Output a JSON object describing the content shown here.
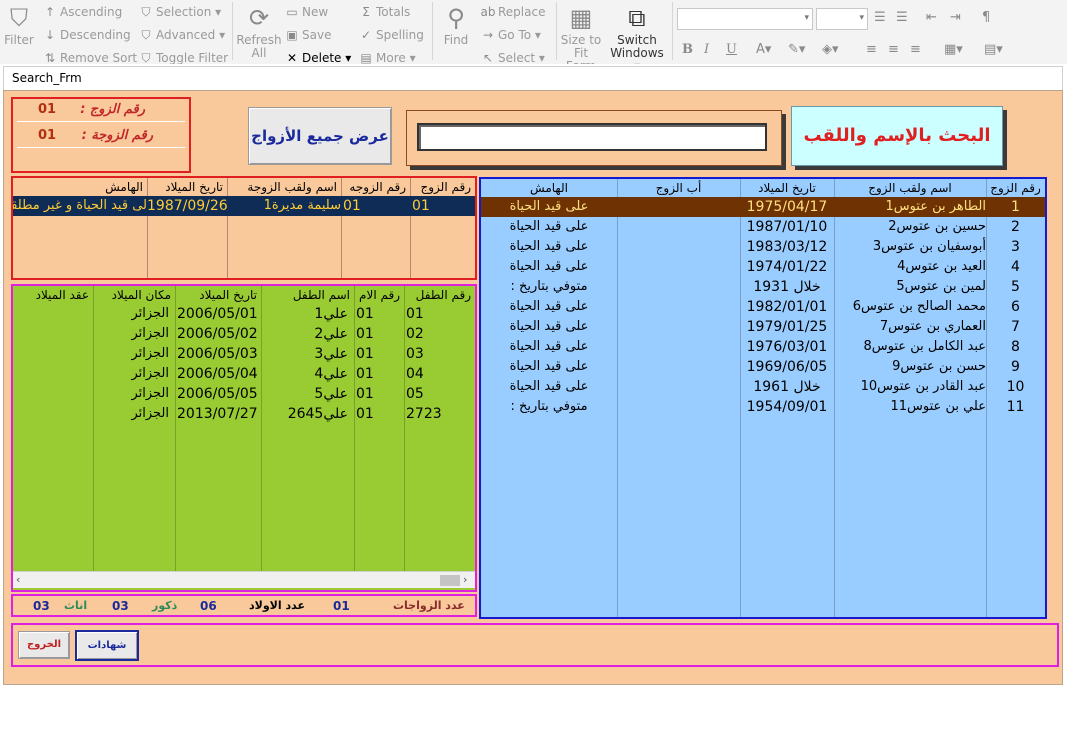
{
  "ribbon": {
    "filter": "Filter",
    "ascending": "Ascending",
    "descending": "Descending",
    "remove_sort": "Remove Sort",
    "selection": "Selection",
    "advanced": "Advanced",
    "toggle_filter": "Toggle Filter",
    "refresh": "Refresh",
    "refresh_all": "All",
    "new": "New",
    "save": "Save",
    "delete": "Delete",
    "totals": "Totals",
    "spelling": "Spelling",
    "more": "More",
    "find": "Find",
    "replace": "Replace",
    "goto": "Go To",
    "select": "Select",
    "size_to_fit": "Size to",
    "size_to_fit2": "Fit Form",
    "switch_windows": "Switch",
    "switch_windows2": "Windows"
  },
  "form": {
    "title": "Search_Frm",
    "husband_no_label": "رقم الزوج  :",
    "husband_no_value": "01",
    "wife_no_label": "رقم الزوجة  :",
    "wife_no_value": "01",
    "show_all_button": "عرض جميع الأزواج",
    "search_placeholder": "",
    "search_title": "البحث بالإسم واللقب"
  },
  "wives_grid": {
    "headers": [
      "رقم الزوج",
      "رقم الزوجه",
      "اسم ولقب الزوجة",
      "تاريخ الميلاد",
      "الهامش"
    ],
    "rows": [
      [
        "01",
        "01",
        "سليمة مديرة1",
        "1987/09/26",
        "لى قيد الحياة و غير مطلقة"
      ]
    ]
  },
  "husbands_grid": {
    "headers": [
      "رقم الزوج",
      "اسم ولقب الزوج",
      "تاريخ الميلاد",
      "أب الزوج",
      "الهامش"
    ],
    "rows": [
      [
        "1",
        "الطاهر بن عتوس1",
        "1975/04/17",
        "",
        "على قيد الحياة"
      ],
      [
        "2",
        "حسين بن عتوس2",
        "1987/01/10",
        "",
        "على قيد الحياة"
      ],
      [
        "3",
        "أبوسفيان بن عتوس3",
        "1983/03/12",
        "",
        "على قيد الحياة"
      ],
      [
        "4",
        "العيد بن عتوس4",
        "1974/01/22",
        "",
        "على قيد الحياة"
      ],
      [
        "5",
        "لمين بن عتوس5",
        "خلال  1931",
        "",
        "متوفي بتاريخ :"
      ],
      [
        "6",
        "محمد الصالح بن عتوس6",
        "1982/01/01",
        "",
        "على قيد الحياة"
      ],
      [
        "7",
        "العماري بن عتوس7",
        "1979/01/25",
        "",
        "على قيد الحياة"
      ],
      [
        "8",
        "عبد الكامل بن عتوس8",
        "1976/03/01",
        "",
        "على قيد الحياة"
      ],
      [
        "9",
        "حسن بن عتوس9",
        "1969/06/05",
        "",
        "على قيد الحياة"
      ],
      [
        "10",
        "عبد القادر بن عتوس10",
        "خلال  1961",
        "",
        "على قيد الحياة"
      ],
      [
        "11",
        "علي بن عتوس11",
        "1954/09/01",
        "",
        "متوفي بتاريخ :"
      ]
    ]
  },
  "children_grid": {
    "headers": [
      "رقم الطفل",
      "رقم الام",
      "اسم الطفل",
      "تاريخ الميلاد",
      "مكان الميلاد",
      "عقد الميلاد"
    ],
    "rows": [
      [
        "01",
        "01",
        "علي1",
        "2006/05/01",
        "الجزائر",
        ""
      ],
      [
        "02",
        "01",
        "علي2",
        "2006/05/02",
        "الجزائر",
        ""
      ],
      [
        "03",
        "01",
        "علي3",
        "2006/05/03",
        "الجزائر",
        ""
      ],
      [
        "04",
        "01",
        "علي4",
        "2006/05/04",
        "الجزائر",
        ""
      ],
      [
        "05",
        "01",
        "علي5",
        "2006/05/05",
        "الجزائر",
        ""
      ],
      [
        "2723",
        "01",
        "علي2645",
        "2013/07/27",
        "الجزائر",
        ""
      ]
    ]
  },
  "counts": {
    "marriages_label": "عدد الزواجات",
    "marriages_value": "01",
    "children_label": "عدد الاولاد",
    "children_value": "06",
    "males_label": "ذكور",
    "males_value": "03",
    "females_label": "اناث",
    "females_value": "03"
  },
  "footer": {
    "certificates_button": "شهادات",
    "exit_button": "الخروج"
  },
  "colors": {
    "form_bg": "#f9c99b",
    "husbands_bg": "#99ccff",
    "children_bg": "#99cc33",
    "selected_row": "#6e3203",
    "wives_selected": "#0f2c56"
  }
}
